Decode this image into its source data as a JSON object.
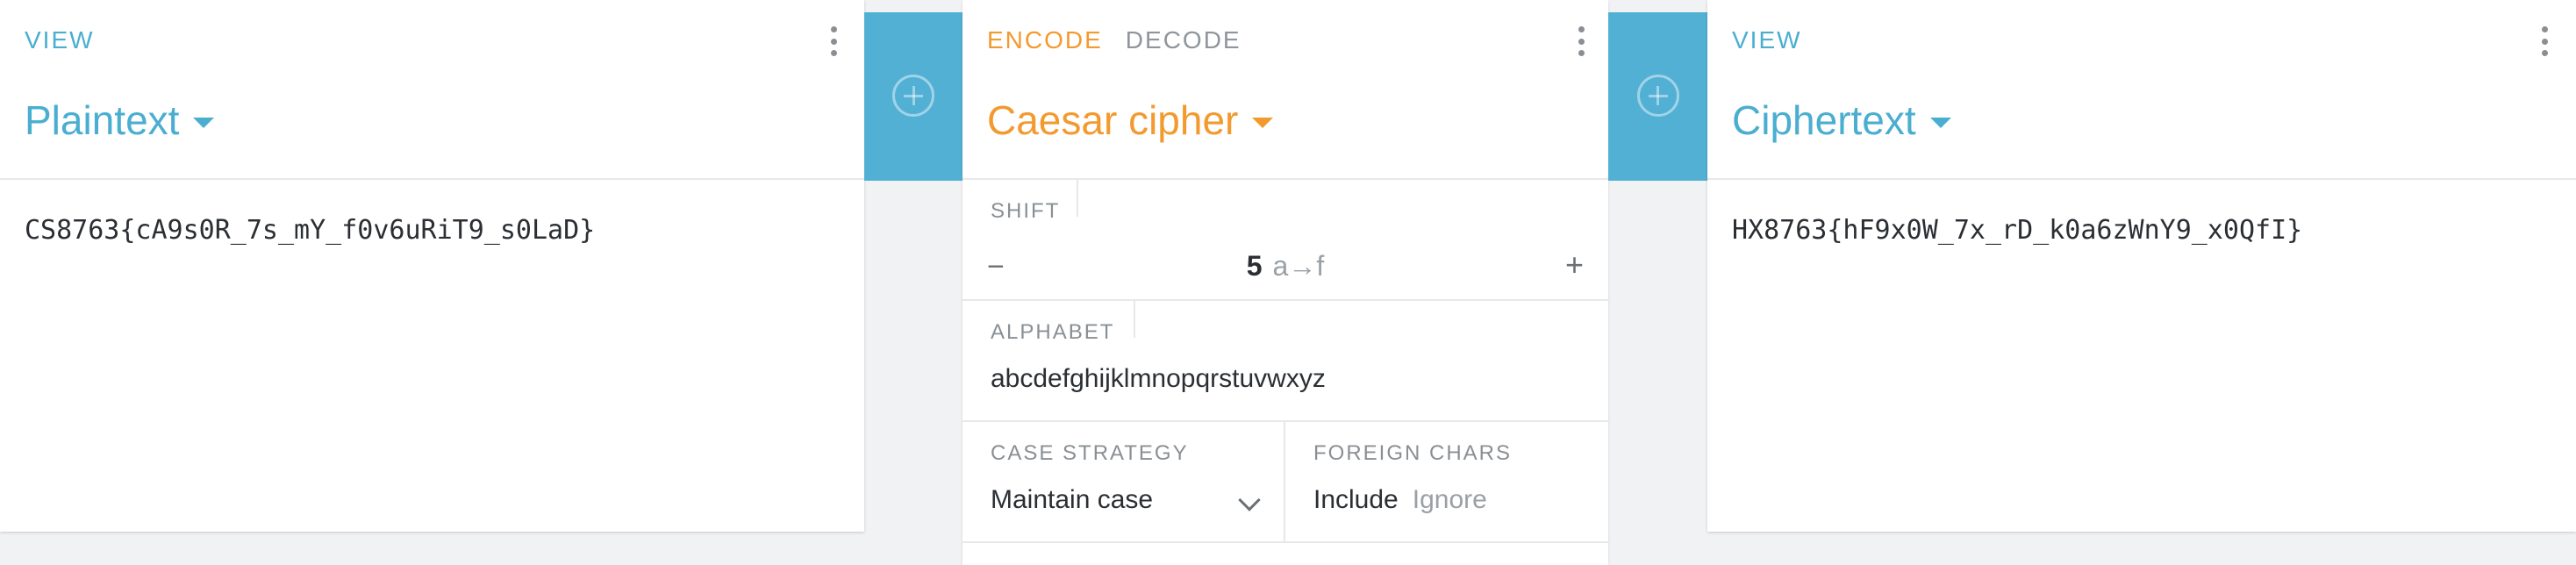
{
  "left_panel": {
    "tab": "VIEW",
    "title": "Plaintext",
    "content": "CS8763{cA9s0R_7s_mY_f0v6uRiT9_s0LaD}"
  },
  "center_panel": {
    "tabs": [
      "ENCODE",
      "DECODE"
    ],
    "title": "Caesar cipher",
    "shift": {
      "label": "SHIFT",
      "value": "5",
      "mapping": "a→f",
      "minus": "−",
      "plus": "+"
    },
    "alphabet": {
      "label": "ALPHABET",
      "value": "abcdefghijklmnopqrstuvwxyz"
    },
    "case_strategy": {
      "label": "CASE STRATEGY",
      "value": "Maintain case"
    },
    "foreign_chars": {
      "label": "FOREIGN CHARS",
      "options": [
        "Include",
        "Ignore"
      ],
      "selected": "Include"
    }
  },
  "right_panel": {
    "tab": "VIEW",
    "title": "Ciphertext",
    "content": "HX8763{hF9x0W_7x_rD_k0a6zWnY9_x0QfI}"
  },
  "colors": {
    "view_accent": "#4aaed0",
    "encode_accent": "#f39a2f",
    "gutter": "#52b0d4"
  },
  "icons": {
    "add": "plus-circle-icon",
    "menu": "more-vertical-icon",
    "dropdown": "caret-down-icon"
  }
}
